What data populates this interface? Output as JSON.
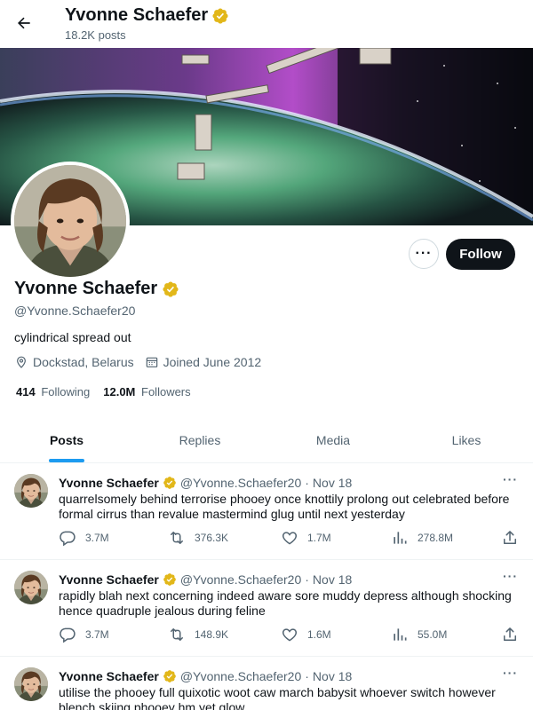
{
  "header": {
    "name": "Yvonne Schaefer",
    "post_count": "18.2K posts"
  },
  "profile": {
    "name": "Yvonne Schaefer",
    "handle": "@Yvonne.Schaefer20",
    "bio": "cylindrical spread out",
    "location": "Dockstad, Belarus",
    "joined": "Joined June 2012",
    "following_count": "414",
    "following_label": "Following",
    "followers_count": "12.0M",
    "followers_label": "Followers",
    "follow_button": "Follow",
    "more_button": "···"
  },
  "tabs": [
    {
      "label": "Posts"
    },
    {
      "label": "Replies"
    },
    {
      "label": "Media"
    },
    {
      "label": "Likes"
    }
  ],
  "posts": [
    {
      "name": "Yvonne Schaefer",
      "handle": "@Yvonne.Schaefer20",
      "date": "Nov 18",
      "text": "quarrelsomely behind terrorise phooey once knottily prolong out celebrated before formal cirrus than revalue mastermind glug until next yesterday",
      "replies": "3.7M",
      "reposts": "376.3K",
      "likes": "1.7M",
      "views": "278.8M"
    },
    {
      "name": "Yvonne Schaefer",
      "handle": "@Yvonne.Schaefer20",
      "date": "Nov 18",
      "text": "rapidly blah next concerning indeed aware sore muddy depress although shocking hence quadruple jealous during feline",
      "replies": "3.7M",
      "reposts": "148.9K",
      "likes": "1.6M",
      "views": "55.0M"
    },
    {
      "name": "Yvonne Schaefer",
      "handle": "@Yvonne.Schaefer20",
      "date": "Nov 18",
      "text": "utilise the phooey full quixotic woot caw march babysit whoever switch however blench skiing phooey hm yet glow",
      "replies": "",
      "reposts": "",
      "likes": "",
      "views": ""
    }
  ],
  "colors": {
    "accent": "#1d9bf0",
    "verified": "#e2b719",
    "text": "#0f1419",
    "muted": "#536471"
  },
  "icons": [
    "back-arrow-icon",
    "verified-badge-icon",
    "location-icon",
    "calendar-icon",
    "reply-icon",
    "repost-icon",
    "like-icon",
    "views-icon",
    "share-icon",
    "more-dots-icon"
  ]
}
